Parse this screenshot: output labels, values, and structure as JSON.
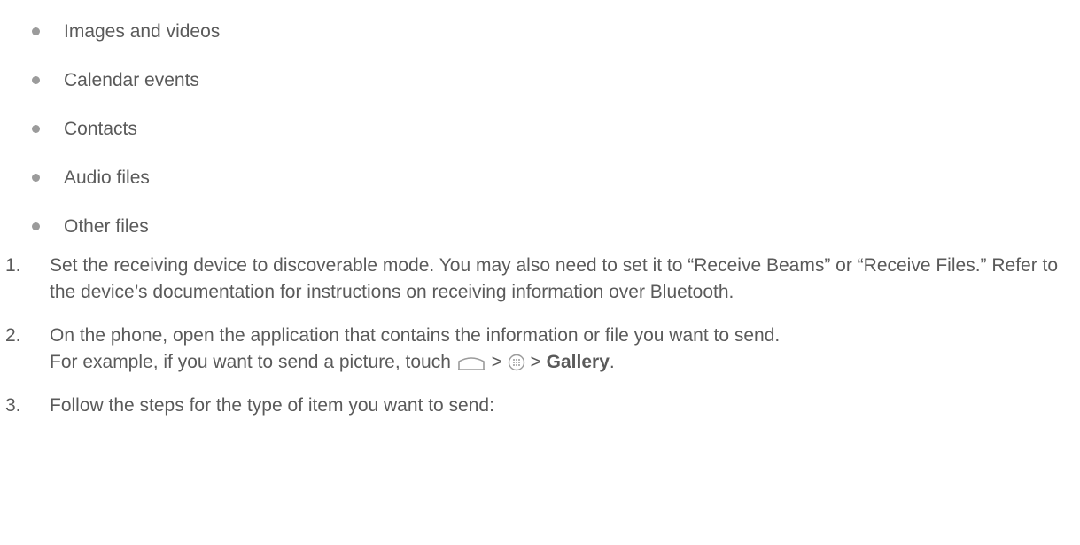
{
  "bullets": [
    "Images and videos",
    "Calendar events",
    "Contacts",
    "Audio files",
    "Other files"
  ],
  "steps": [
    {
      "number": "1.",
      "text": "Set the receiving device to discoverable mode. You may also need to set it to “Receive Beams” or “Receive Files.” Refer to the device’s documentation for instructions on receiving information over Bluetooth."
    },
    {
      "number": "2.",
      "text_line1": "On the phone, open the application that contains the information or file you want to send.",
      "text_line2_prefix": "For example, if you want to send a picture, touch",
      "sep1": ">",
      "sep2": ">",
      "app_label": "Gallery",
      "end": "."
    },
    {
      "number": "3.",
      "text": "Follow the steps for the type of item you want to send:"
    }
  ],
  "icons": {
    "home": "home-icon",
    "apps": "apps-icon"
  },
  "colors": {
    "text": "#5a5a5a",
    "bullet": "#9b9b9b"
  }
}
